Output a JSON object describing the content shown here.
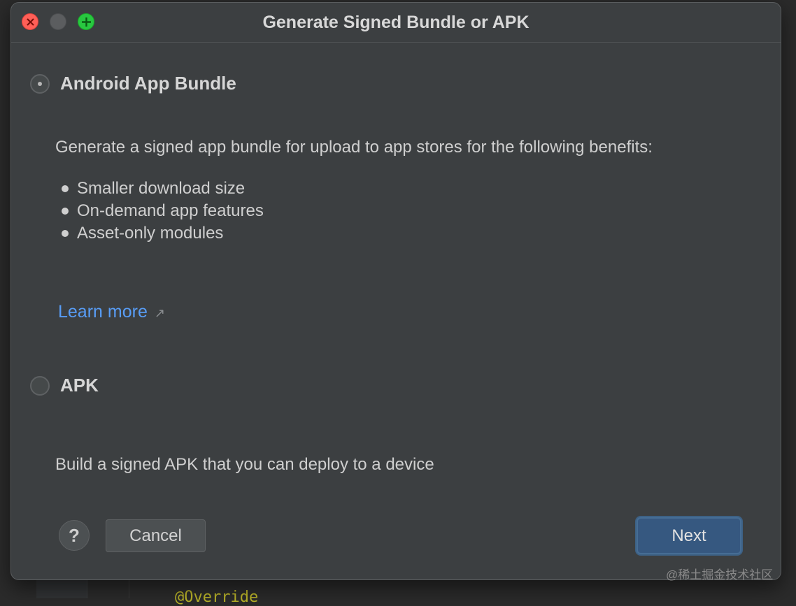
{
  "window": {
    "title": "Generate Signed Bundle or APK"
  },
  "options": [
    {
      "label": "Android App Bundle",
      "selected": true,
      "description": "Generate a signed app bundle for upload to app stores for the following benefits:",
      "benefits": [
        "Smaller download size",
        "On-demand app features",
        "Asset-only modules"
      ],
      "learn_more": "Learn more",
      "learn_more_icon": "external-link-icon"
    },
    {
      "label": "APK",
      "selected": false,
      "description": "Build a signed APK that you can deploy to a device"
    }
  ],
  "footer": {
    "help_label": "?",
    "cancel_label": "Cancel",
    "next_label": "Next"
  },
  "background": {
    "code_text": "@Override"
  },
  "watermark": "@稀土掘金技术社区",
  "colors": {
    "dialog_bg": "#3c3f41",
    "link": "#589df6",
    "primary_button": "#365880",
    "close": "#ff5f57",
    "zoom": "#28c840"
  }
}
